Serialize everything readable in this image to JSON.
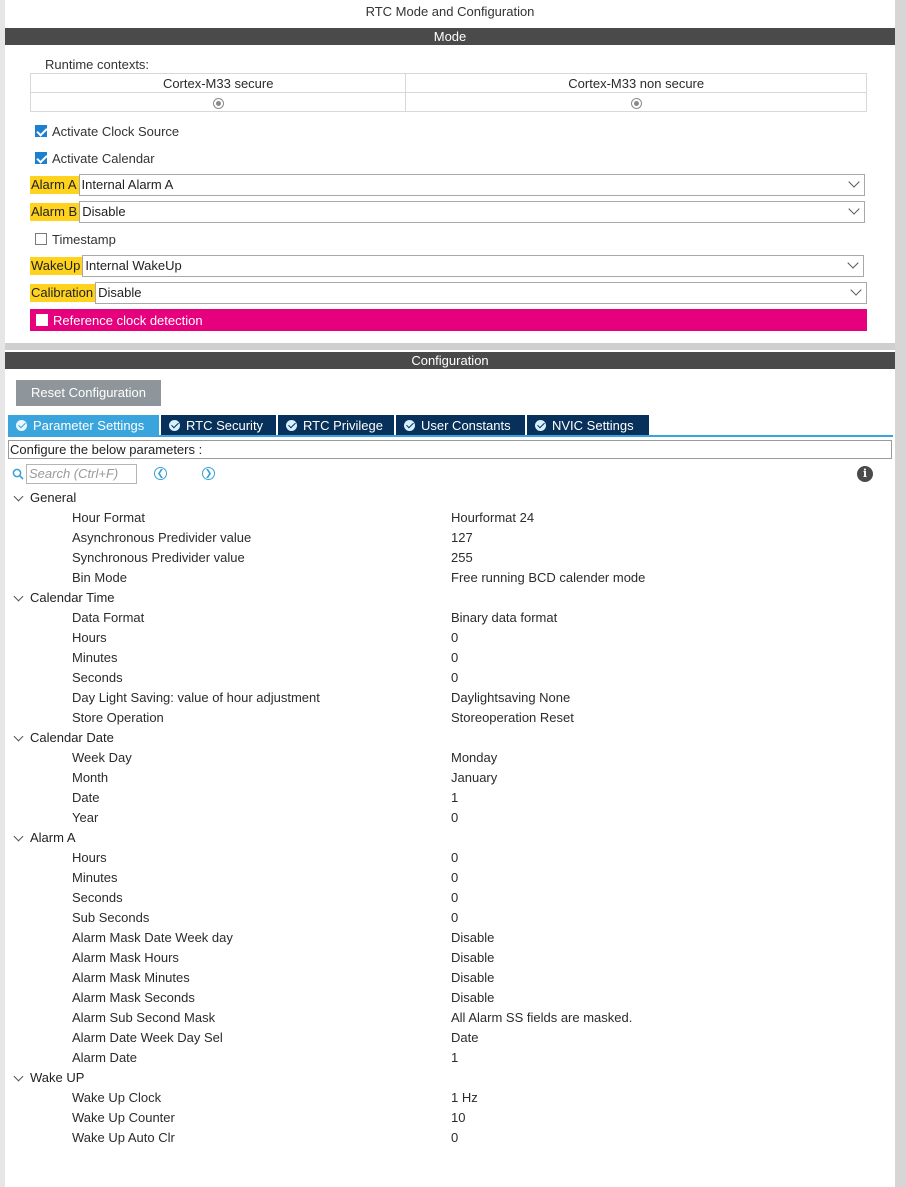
{
  "window_title": "RTC Mode and Configuration",
  "mode": {
    "section_title": "Mode",
    "runtime_label": "Runtime contexts:",
    "contexts": [
      "Cortex-M33 secure",
      "Cortex-M33 non secure"
    ],
    "activate_clock_source": "Activate Clock Source",
    "activate_calendar": "Activate Calendar",
    "alarm_a": {
      "label": "Alarm A",
      "value": "Internal Alarm A"
    },
    "alarm_b": {
      "label": "Alarm B",
      "value": "Disable"
    },
    "timestamp": "Timestamp",
    "wakeup": {
      "label": "WakeUp",
      "value": "Internal WakeUp"
    },
    "calibration": {
      "label": "Calibration",
      "value": "Disable"
    },
    "reference_clock": "Reference clock detection",
    "highlight_color": "#ffd21e",
    "error_color": "#e6007e"
  },
  "config": {
    "section_title": "Configuration",
    "reset_button": "Reset Configuration",
    "tabs": [
      "Parameter Settings",
      "RTC Security",
      "RTC Privilege",
      "User Constants",
      "NVIC Settings"
    ],
    "configure_text": "Configure the below parameters :",
    "search_placeholder": "Search (Ctrl+F)"
  },
  "groups": [
    {
      "name": "General",
      "params": [
        [
          "Hour Format",
          "Hourformat 24"
        ],
        [
          "Asynchronous Predivider value",
          "127"
        ],
        [
          "Synchronous Predivider value",
          "255"
        ],
        [
          "Bin Mode",
          "Free running BCD calender mode"
        ]
      ]
    },
    {
      "name": "Calendar Time",
      "params": [
        [
          "Data Format",
          "Binary data format"
        ],
        [
          "Hours",
          "0"
        ],
        [
          "Minutes",
          "0"
        ],
        [
          "Seconds",
          "0"
        ],
        [
          "Day Light Saving: value of hour adjustment",
          "Daylightsaving None"
        ],
        [
          "Store Operation",
          "Storeoperation Reset"
        ]
      ]
    },
    {
      "name": "Calendar Date",
      "params": [
        [
          "Week Day",
          "Monday"
        ],
        [
          "Month",
          "January"
        ],
        [
          "Date",
          "1"
        ],
        [
          "Year",
          "0"
        ]
      ]
    },
    {
      "name": "Alarm A",
      "params": [
        [
          "Hours",
          "0"
        ],
        [
          "Minutes",
          "0"
        ],
        [
          "Seconds",
          "0"
        ],
        [
          "Sub Seconds",
          "0"
        ],
        [
          "Alarm Mask Date Week day",
          "Disable"
        ],
        [
          "Alarm Mask Hours",
          "Disable"
        ],
        [
          "Alarm Mask Minutes",
          "Disable"
        ],
        [
          "Alarm Mask Seconds",
          "Disable"
        ],
        [
          "Alarm Sub Second Mask",
          "All Alarm SS fields are masked."
        ],
        [
          "Alarm Date Week Day Sel",
          "Date"
        ],
        [
          "Alarm Date",
          "1"
        ]
      ]
    },
    {
      "name": "Wake UP",
      "params": [
        [
          "Wake Up Clock",
          "1 Hz"
        ],
        [
          "Wake Up Counter",
          "10"
        ],
        [
          "Wake Up Auto Clr",
          "0"
        ]
      ]
    }
  ]
}
